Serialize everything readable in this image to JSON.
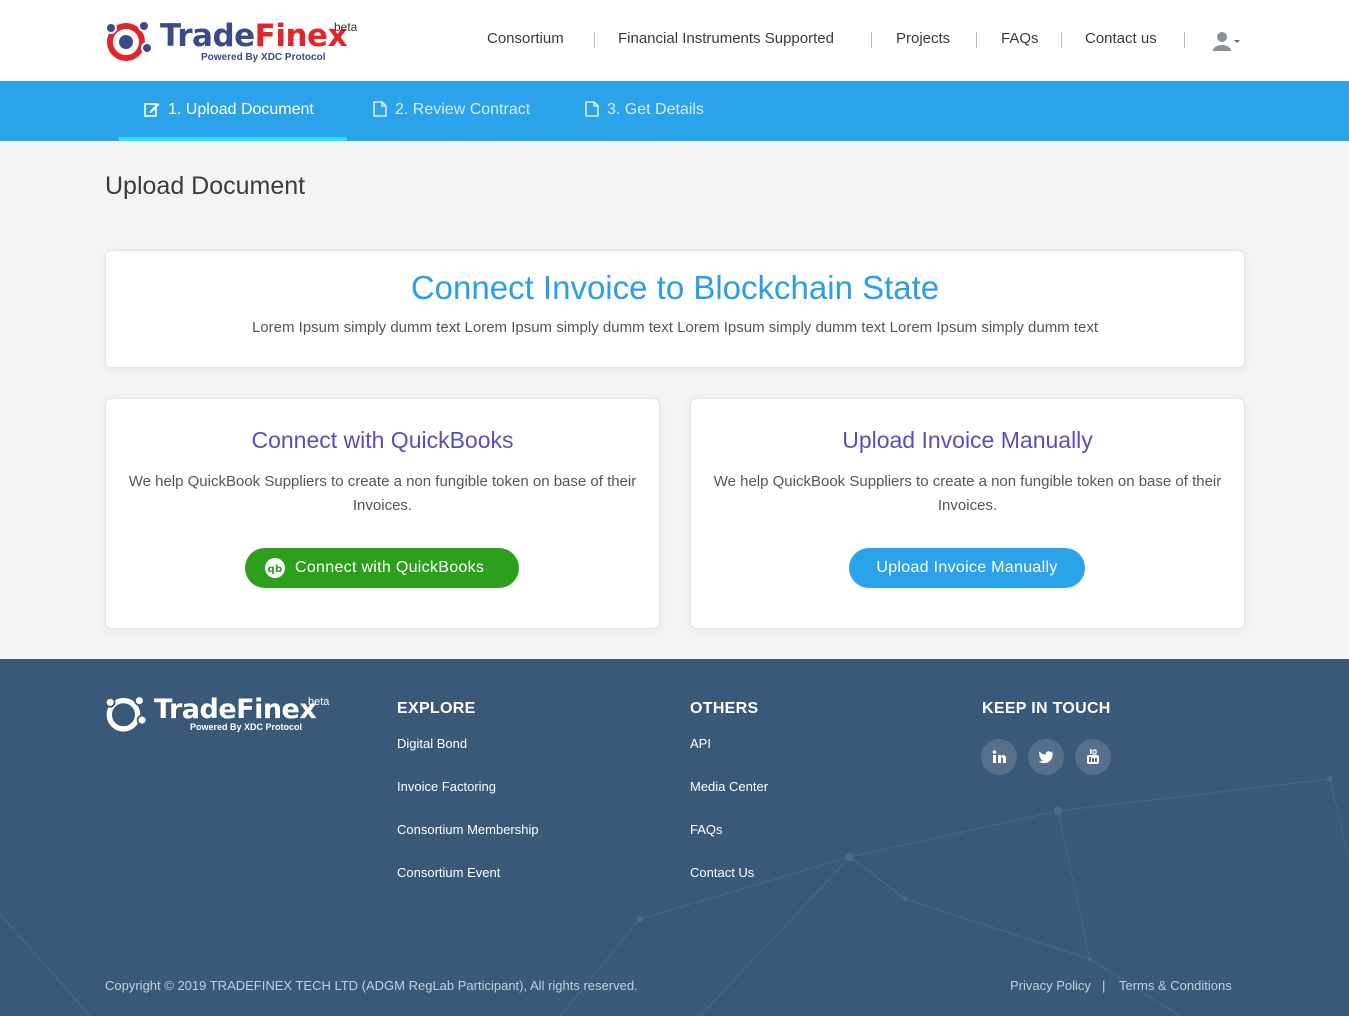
{
  "header": {
    "logo_text_1": "Trade",
    "logo_text_2": "Finex",
    "logo_beta": "beta",
    "logo_powered": "Powered By XDC Protocol",
    "nav": [
      "Consortium",
      "Financial Instruments Supported",
      "Projects",
      "FAQs",
      "Contact us"
    ],
    "user_icon": "user-icon"
  },
  "steps": [
    {
      "label": "1. Upload Document",
      "icon": "edit-icon",
      "active": true
    },
    {
      "label": "2. Review Contract",
      "icon": "document-icon",
      "active": false
    },
    {
      "label": "3. Get Details",
      "icon": "document-icon",
      "active": false
    }
  ],
  "page_title": "Upload Document",
  "hero": {
    "title": "Connect Invoice to Blockchain State",
    "text": "Lorem Ipsum simply dumm text Lorem Ipsum simply dumm text Lorem Ipsum simply dumm text Lorem Ipsum simply dumm text"
  },
  "options": [
    {
      "title": "Connect with QuickBooks",
      "text": "We help QuickBook Suppliers to create a non fungible token on base of their Invoices.",
      "button": "Connect with QuickBooks",
      "button_color": "#2ca01c"
    },
    {
      "title": "Upload Invoice Manually",
      "text": "We help QuickBook Suppliers to create a non fungible token on base of their Invoices.",
      "button": "Upload Invoice Manually",
      "button_color": "#2aa3ea"
    }
  ],
  "footer": {
    "logo_text": "TradeFinex",
    "logo_beta": "beta",
    "logo_powered": "Powered By XDC Protocol",
    "explore": {
      "title": "EXPLORE",
      "links": [
        "Digital Bond",
        "Invoice Factoring",
        "Consortium Membership",
        "Consortium Event"
      ]
    },
    "others": {
      "title": "OTHERS",
      "links": [
        "API",
        "Media Center",
        "FAQs",
        "Contact Us"
      ]
    },
    "keep_in_touch": {
      "title": "KEEP IN TOUCH",
      "social": [
        "linkedin-icon",
        "twitter-icon",
        "youtube-icon"
      ]
    },
    "copyright": "Copyright © 2019 TRADEFINEX TECH LTD (ADGM RegLab Participant), All rights reserved.",
    "privacy": "Privacy Policy",
    "separator": "|",
    "terms": "Terms & Conditions"
  },
  "colors": {
    "accent_blue": "#2aa3ea",
    "step_underline": "#29e0f5",
    "heading_purple": "#5a4fb6",
    "footer_bg": "#3a5878"
  }
}
